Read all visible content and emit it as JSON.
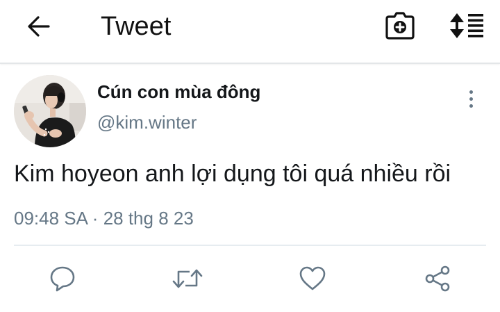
{
  "header": {
    "title": "Tweet",
    "back_icon": "arrow-left-icon",
    "camera_icon": "camera-add-icon",
    "sort_icon": "sort-list-icon"
  },
  "tweet": {
    "author": {
      "name": "Cún con mùa đông",
      "handle": "@kim.winter",
      "avatar_icon": "avatar-photo"
    },
    "text": "Kim hoyeon anh lợi dụng tôi quá nhiều rồi",
    "time": "09:48 SA",
    "separator": "·",
    "date": "28 thg 8 23"
  },
  "actions": {
    "reply_icon": "reply-icon",
    "retweet_icon": "retweet-icon",
    "like_icon": "heart-icon",
    "share_icon": "share-icon"
  },
  "colors": {
    "text": "#14171a",
    "secondary": "#657786",
    "divider": "#e6ecf0"
  }
}
